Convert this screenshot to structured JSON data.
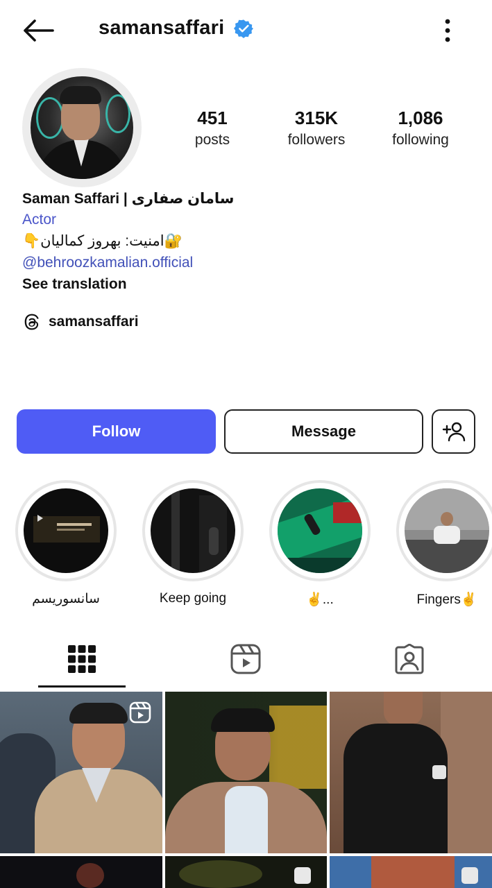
{
  "header": {
    "username": "samansaffari",
    "verified": true
  },
  "stats": [
    {
      "value": "451",
      "label": "posts"
    },
    {
      "value": "315K",
      "label": "followers"
    },
    {
      "value": "1,086",
      "label": "following"
    }
  ],
  "bio": {
    "name": "Saman Saffari | سامان صفاری",
    "category": "Actor",
    "line": "👇امنیت: بهروز کمالیان🔐",
    "mention": "@behroozkamalian.official",
    "translate": "See translation"
  },
  "threads": {
    "label": "samansaffari",
    "icon": "threads-icon"
  },
  "actions": {
    "follow": "Follow",
    "message": "Message",
    "add_icon": "add-user-icon"
  },
  "highlights": [
    {
      "label": "سانسوریسم"
    },
    {
      "label": "Keep going"
    },
    {
      "label": "✌️..."
    },
    {
      "label": "Fingers✌️"
    }
  ],
  "tabs": [
    {
      "name": "posts",
      "icon": "grid-icon",
      "selected": true
    },
    {
      "name": "reels",
      "icon": "reels-icon",
      "selected": false
    },
    {
      "name": "tagged",
      "icon": "tagged-icon",
      "selected": false
    }
  ],
  "colors": {
    "accent": "#4f5cf5",
    "link": "#4150b8",
    "verified": "#3897f0"
  }
}
